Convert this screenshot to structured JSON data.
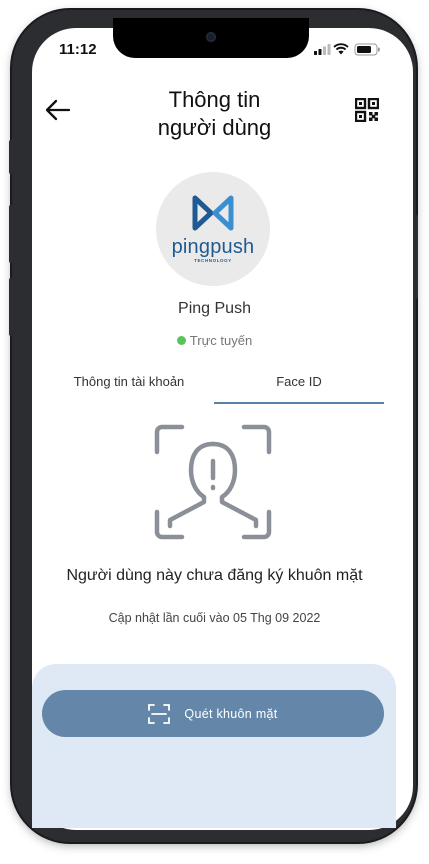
{
  "status_bar": {
    "time": "11:12"
  },
  "header": {
    "title_line1": "Thông tin",
    "title_line2": "người dùng"
  },
  "icons": {
    "back": "arrow-left-icon",
    "qr": "qr-code-icon",
    "face": "face-scan-icon",
    "scan": "scan-frame-icon"
  },
  "profile": {
    "logo_text": "pingpush",
    "logo_subtext": "TECHNOLOGY",
    "name": "Ping Push",
    "status": "Trực tuyến"
  },
  "tabs": [
    {
      "label": "Thông tin tài khoản",
      "active": false
    },
    {
      "label": "Face ID",
      "active": true
    }
  ],
  "face_id": {
    "message": "Người dùng này chưa đăng ký khuôn mặt",
    "last_updated": "Cập nhật lần cuối vào 05 Thg 09 2022"
  },
  "actions": {
    "scan_label": "Quét khuôn mặt"
  },
  "colors": {
    "accent": "#6386a9",
    "online": "#5ac35a",
    "bottom_bg": "#dfe9f5",
    "brand": "#1f5a92"
  }
}
